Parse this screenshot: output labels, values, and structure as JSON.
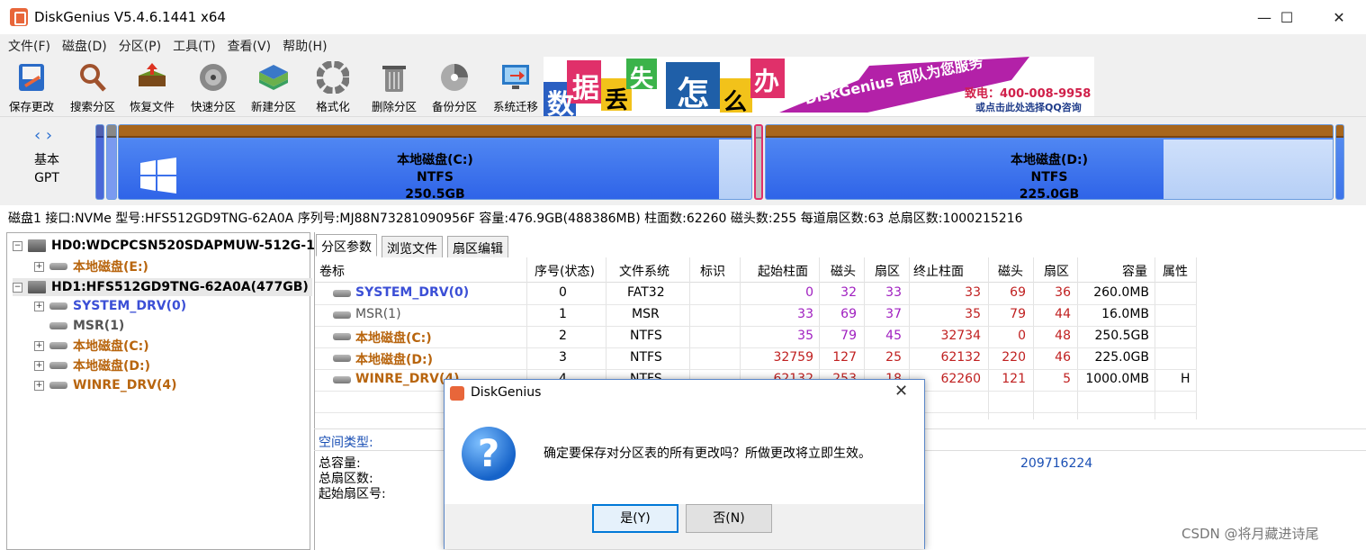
{
  "app": {
    "title": "DiskGenius V5.4.6.1441 x64"
  },
  "window": {
    "minimize": "—",
    "maximize": "☐",
    "close": "✕"
  },
  "menu": [
    "文件(F)",
    "磁盘(D)",
    "分区(P)",
    "工具(T)",
    "查看(V)",
    "帮助(H)"
  ],
  "toolbar": [
    {
      "label": "保存更改",
      "icon": "save-icon"
    },
    {
      "label": "搜索分区",
      "icon": "search-icon"
    },
    {
      "label": "恢复文件",
      "icon": "recover-icon"
    },
    {
      "label": "快速分区",
      "icon": "quick-partition-icon"
    },
    {
      "label": "新建分区",
      "icon": "new-partition-icon"
    },
    {
      "label": "格式化",
      "icon": "format-icon"
    },
    {
      "label": "删除分区",
      "icon": "delete-icon"
    },
    {
      "label": "备份分区",
      "icon": "backup-icon"
    },
    {
      "label": "系统迁移",
      "icon": "migrate-icon"
    }
  ],
  "ad": {
    "chars": [
      "数",
      "据",
      "丢",
      "失",
      "怎",
      "么",
      "办"
    ],
    "brand": "DiskGenius 团队为您服务",
    "phone": "致电：400-008-9958",
    "qq": "或点击此处选择QQ咨询"
  },
  "diskmap": {
    "nav": "‹ ›",
    "type_line1": "基本",
    "type_line2": "GPT",
    "c": {
      "name": "本地磁盘(C:)",
      "fs": "NTFS",
      "size": "250.5GB"
    },
    "d": {
      "name": "本地磁盘(D:)",
      "fs": "NTFS",
      "size": "225.0GB"
    }
  },
  "infobar": "磁盘1 接口:NVMe  型号:HFS512GD9TNG-62A0A  序列号:MJ88N73281090956F  容量:476.9GB(488386MB)  柱面数:62260  磁头数:255  每道扇区数:63  总扇区数:1000215216",
  "tree": [
    {
      "label": "HD0:WDCPCSN520SDAPMUW-512G-1",
      "kind": "disk",
      "color": "#000"
    },
    {
      "label": "本地磁盘(E:)",
      "kind": "part",
      "color": "#b8650e"
    },
    {
      "label": "HD1:HFS512GD9TNG-62A0A(477GB)",
      "kind": "disk",
      "color": "#000"
    },
    {
      "label": "SYSTEM_DRV(0)",
      "kind": "part",
      "color": "#3b4fd6"
    },
    {
      "label": "MSR(1)",
      "kind": "part",
      "color": "#555"
    },
    {
      "label": "本地磁盘(C:)",
      "kind": "part",
      "color": "#b8650e"
    },
    {
      "label": "本地磁盘(D:)",
      "kind": "part",
      "color": "#b8650e"
    },
    {
      "label": "WINRE_DRV(4)",
      "kind": "part",
      "color": "#b8650e"
    }
  ],
  "tabs": [
    "分区参数",
    "浏览文件",
    "扇区编辑"
  ],
  "columns": [
    "卷标",
    "序号(状态)",
    "文件系统",
    "标识",
    "起始柱面",
    "磁头",
    "扇区",
    "终止柱面",
    "磁头",
    "扇区",
    "容量",
    "属性"
  ],
  "rows": [
    {
      "name": "SYSTEM_DRV(0)",
      "color": "#3b4fd6",
      "idx": "0",
      "fs": "FAT32",
      "flag": "",
      "sc": "0",
      "sh": "32",
      "ss": "33",
      "ec": "33",
      "eh": "69",
      "es": "36",
      "cap": "260.0MB",
      "attr": ""
    },
    {
      "name": "MSR(1)",
      "color": "#555",
      "idx": "1",
      "fs": "MSR",
      "flag": "",
      "sc": "33",
      "sh": "69",
      "ss": "37",
      "ec": "35",
      "eh": "79",
      "es": "44",
      "cap": "16.0MB",
      "attr": ""
    },
    {
      "name": "本地磁盘(C:)",
      "color": "#b8650e",
      "idx": "2",
      "fs": "NTFS",
      "flag": "",
      "sc": "35",
      "sh": "79",
      "ss": "45",
      "ec": "32734",
      "eh": "0",
      "es": "48",
      "cap": "250.5GB",
      "attr": ""
    },
    {
      "name": "本地磁盘(D:)",
      "color": "#b8650e",
      "idx": "3",
      "fs": "NTFS",
      "flag": "",
      "sc": "32759",
      "sh": "127",
      "ss": "25",
      "ec": "62132",
      "eh": "220",
      "es": "46",
      "cap": "225.0GB",
      "attr": ""
    },
    {
      "name": "WINRE_DRV(4)",
      "color": "#b8650e",
      "idx": "4",
      "fs": "NTFS",
      "flag": "",
      "sc": "62132",
      "sh": "253",
      "ss": "18",
      "ec": "62260",
      "eh": "121",
      "es": "5",
      "cap": "1000.0MB",
      "attr": "H"
    }
  ],
  "details": {
    "space_type": "空间类型:",
    "total_cap": "总容量:",
    "total_sectors": "总扇区数:",
    "start_sector": "起始扇区号:",
    "value": "209716224"
  },
  "dialog": {
    "title": "DiskGenius",
    "close": "✕",
    "icon_glyph": "?",
    "message": "确定要保存对分区表的所有更改吗？所做更改将立即生效。",
    "yes": "是(Y)",
    "no": "否(N)"
  },
  "watermark": "CSDN @将月藏进诗尾"
}
